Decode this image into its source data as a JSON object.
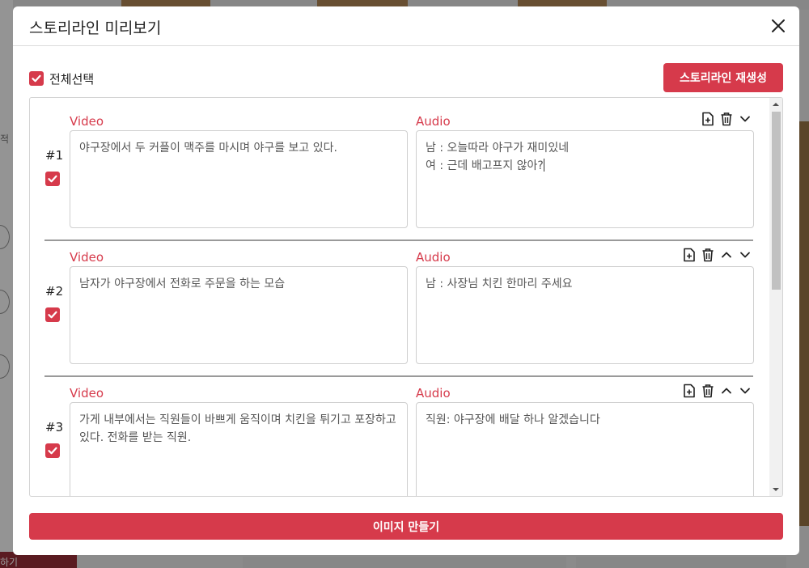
{
  "modal": {
    "title": "스토리라인 미리보기",
    "select_all_label": "전체선택",
    "regenerate_label": "스토리라인 재생성",
    "make_images_label": "이미지 만들기",
    "close_icon": "close-icon"
  },
  "scenes": [
    {
      "number": "#1",
      "checked": true,
      "video_label": "Video",
      "audio_label": "Audio",
      "video_text": "야구장에서 두 커플이 맥주를 마시며 야구를 보고 있다.",
      "audio_line1": "남 : 오늘따라 야구가 재미있네",
      "audio_line2": "여 : 근데 배고프지 않아?",
      "tools": [
        "add-document-icon",
        "trash-icon",
        "chevron-down-icon"
      ]
    },
    {
      "number": "#2",
      "checked": true,
      "video_label": "Video",
      "audio_label": "Audio",
      "video_text": "남자가 야구장에서 전화로 주문을 하는 모습",
      "audio_text": "남 : 사장님 치킨 한마리 주세요",
      "tools": [
        "add-document-icon",
        "trash-icon",
        "chevron-up-icon",
        "chevron-down-icon"
      ]
    },
    {
      "number": "#3",
      "checked": true,
      "video_label": "Video",
      "audio_label": "Audio",
      "video_text": "가게 내부에서는 직원들이 바쁘게 움직이며 치킨을 튀기고 포장하고 있다. 전화를 받는 직원.",
      "audio_text": "직원: 야구장에 배달 하나 알겠습니다",
      "tools": [
        "add-document-icon",
        "trash-icon",
        "chevron-up-icon",
        "chevron-down-icon"
      ]
    }
  ],
  "background": {
    "left_button_label": "하기",
    "left_side_text": "적"
  },
  "colors": {
    "accent": "#d63a4b",
    "overlay": "#7b7b7b"
  }
}
